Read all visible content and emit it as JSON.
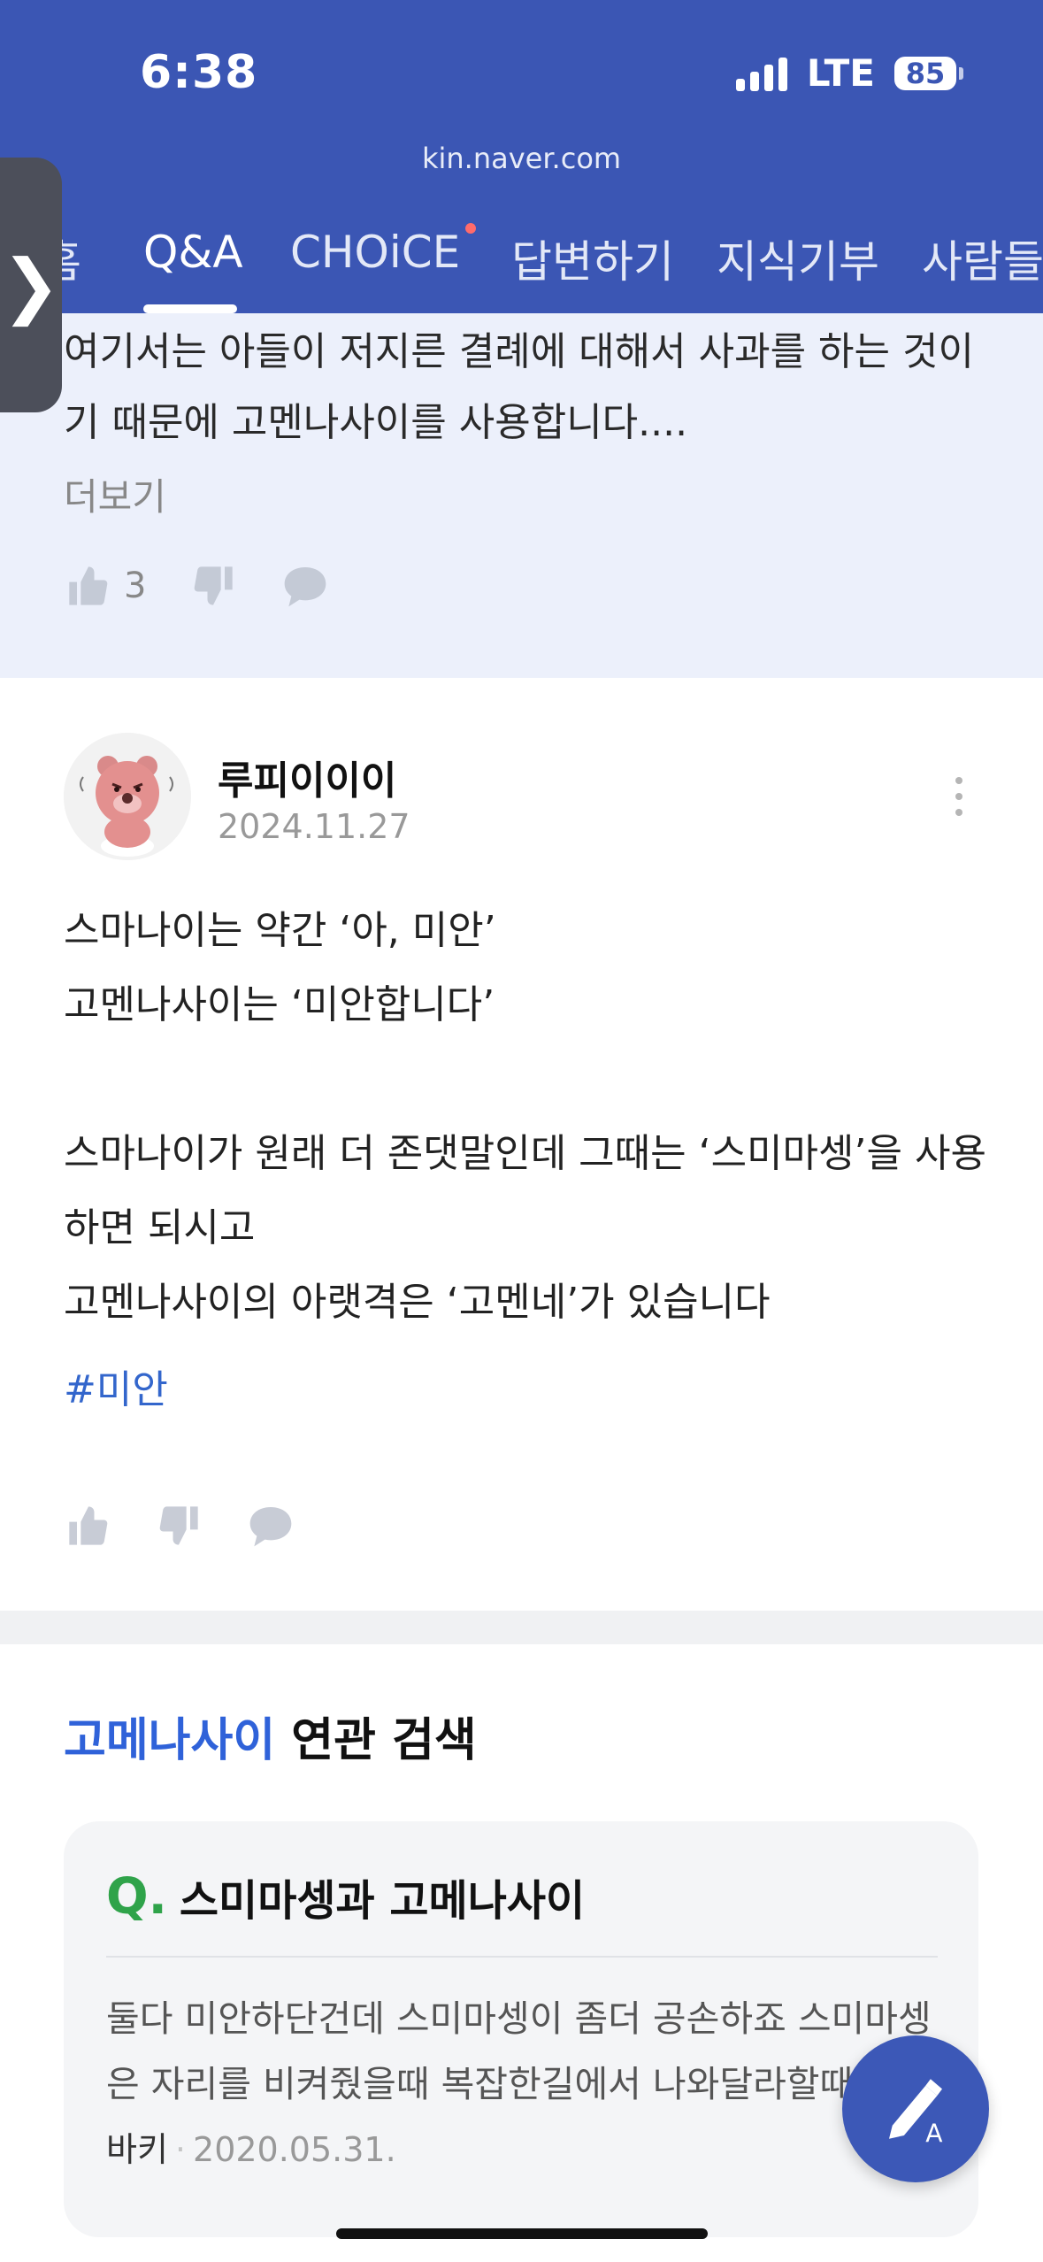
{
  "status": {
    "time": "6:38",
    "network": "LTE",
    "battery": "85"
  },
  "browser": {
    "url": "kin.naver.com"
  },
  "tabs": [
    {
      "label": "홈"
    },
    {
      "label": "Q&A"
    },
    {
      "label": "CHOiCE"
    },
    {
      "label": "답변하기"
    },
    {
      "label": "지식기부"
    },
    {
      "label": "사람들"
    }
  ],
  "active_tab": "Q&A",
  "answer1": {
    "text": "여기서는 아들이 저지른 결례에 대해서 사과를 하는 것이기 때문에 고멘나사이를 사용합니다....",
    "more": "더보기",
    "likes": "3"
  },
  "answer2": {
    "author": "루피이이이",
    "date": "2024.11.27",
    "body": [
      "스마나이는 약간 ‘아, 미안’",
      "고멘나사이는 ‘미안합니다’",
      "",
      "스마나이가 원래 더 존댓말인데 그때는 ‘스미마셍’을 사용",
      "하면 되시고",
      "고멘나사이의 아랫격은 ‘고멘네’가 있습니다"
    ],
    "hashtag": "#미안"
  },
  "related": {
    "keyword": "고메나사이",
    "suffix": " 연관 검색",
    "card": {
      "q_mark": "Q.",
      "question": "스미마셍과 고메나사이",
      "snippet": "둘다 미안하단건데 스미마셍이 좀더 공손하죠 스미마셍은 자리를 비켜줬을때 복잡한길에서 나와달라할때",
      "author": "바키",
      "sep": "·",
      "date": "2020.05.31."
    }
  },
  "colors": {
    "header_bg": "#3b56b4",
    "highlight_bg": "#ecf0fb",
    "link": "#3366cc",
    "keyword": "#2f62d9",
    "q_green": "#2fa34a"
  },
  "icons": [
    "thumbs-up-icon",
    "thumbs-down-icon",
    "comment-icon",
    "kebab-menu-icon",
    "write-answer-icon",
    "chevron-right-icon"
  ]
}
